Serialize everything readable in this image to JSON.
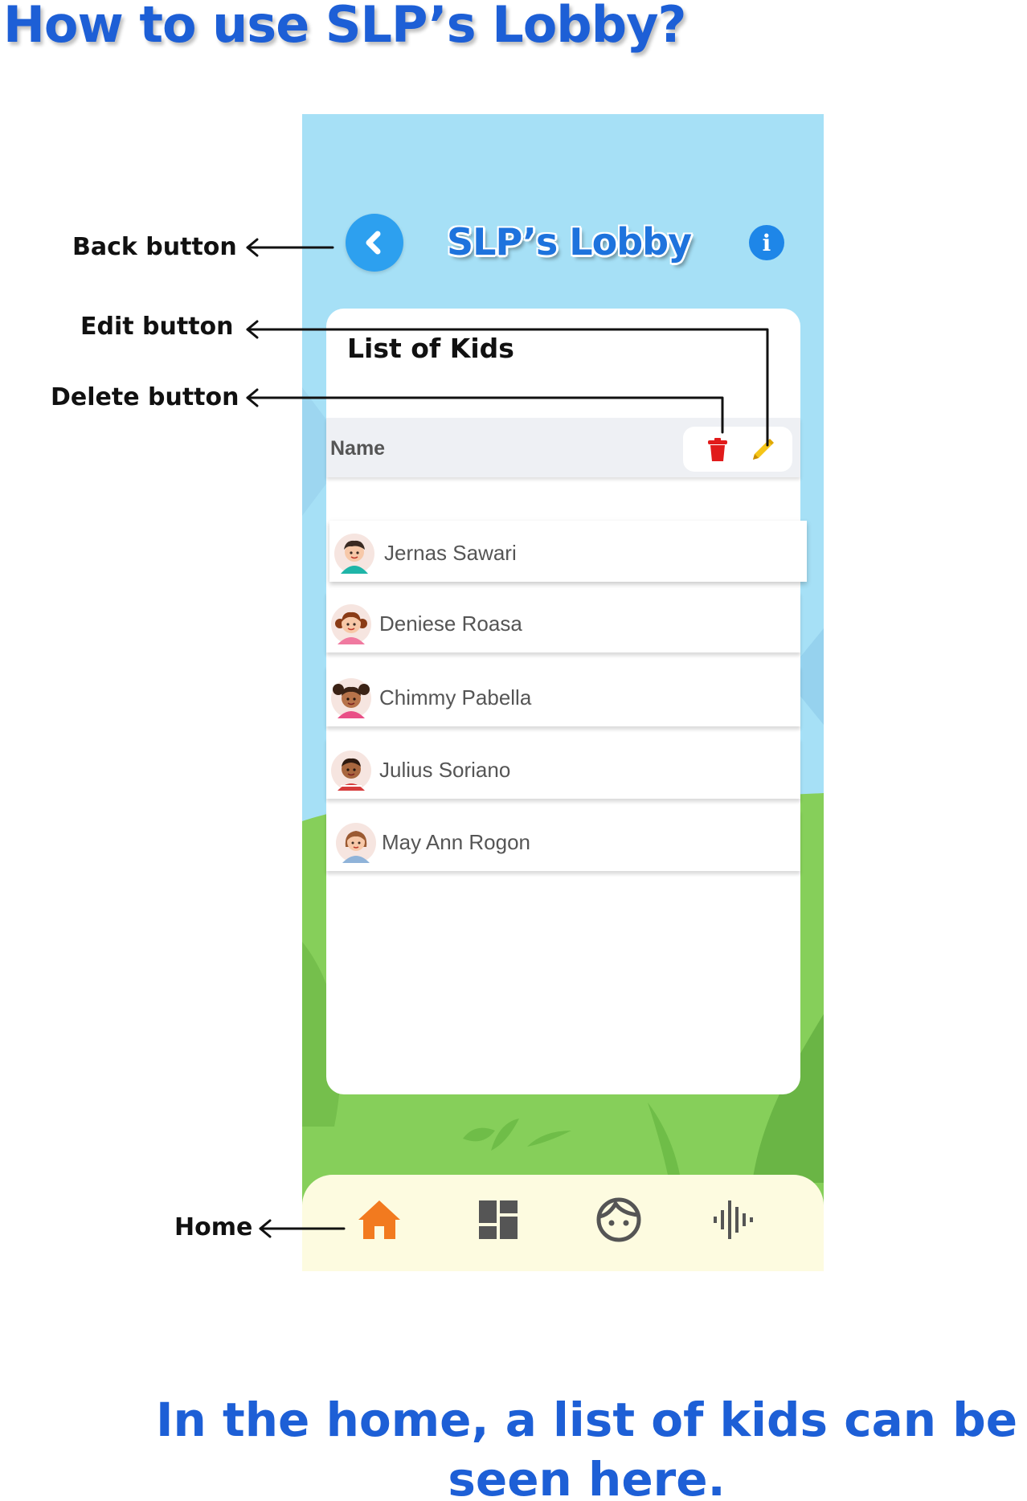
{
  "page": {
    "title": "How to use SLP’s Lobby?",
    "caption": "In the home, a list of kids can be seen here."
  },
  "app": {
    "title": "SLP’s Lobby",
    "info_glyph": "i",
    "card_title": "List of Kids",
    "table_header": "Name",
    "kids": [
      {
        "name": "Jernas Sawari",
        "avatar": "boy-avatar-icon"
      },
      {
        "name": "Deniese Roasa",
        "avatar": "girl-avatar-icon"
      },
      {
        "name": "Chimmy Pabella",
        "avatar": "girl-puffs-avatar-icon"
      },
      {
        "name": "Julius Soriano",
        "avatar": "boy-avatar-icon"
      },
      {
        "name": "May Ann Rogon",
        "avatar": "girl-avatar-icon"
      }
    ],
    "nav": [
      "home-icon",
      "dashboard-icon",
      "face-icon",
      "audio-wave-icon"
    ]
  },
  "annotations": {
    "back": "Back button",
    "edit": "Edit button",
    "delete": "Delete button",
    "home": "Home"
  },
  "colors": {
    "accent_blue": "#1d5fd6",
    "sky": "#a6e0f6",
    "grass": "#86cf5a",
    "home_active": "#f27a1f",
    "delete_red": "#e11b1b",
    "edit_yellow": "#f5c518"
  }
}
